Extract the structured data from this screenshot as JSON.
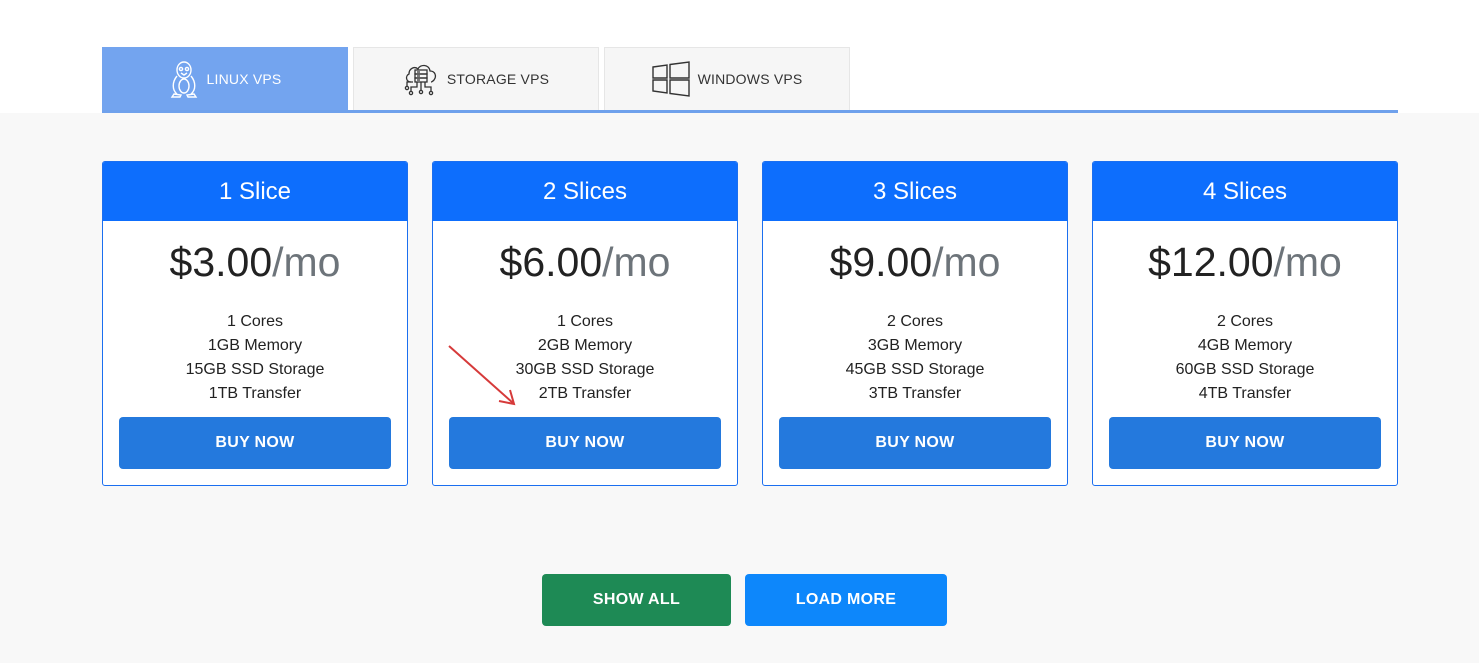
{
  "tabs": [
    {
      "label": "LINUX VPS",
      "icon": "linux-penguin-icon",
      "active": true
    },
    {
      "label": "STORAGE VPS",
      "icon": "cloud-storage-icon",
      "active": false
    },
    {
      "label": "WINDOWS VPS",
      "icon": "windows-logo-icon",
      "active": false
    }
  ],
  "plans": [
    {
      "title": "1 Slice",
      "price": "$3.00",
      "per": "/mo",
      "features": [
        "1 Cores",
        "1GB Memory",
        "15GB SSD Storage",
        "1TB Transfer"
      ],
      "button": "BUY NOW"
    },
    {
      "title": "2 Slices",
      "price": "$6.00",
      "per": "/mo",
      "features": [
        "1 Cores",
        "2GB Memory",
        "30GB SSD Storage",
        "2TB Transfer"
      ],
      "button": "BUY NOW"
    },
    {
      "title": "3 Slices",
      "price": "$9.00",
      "per": "/mo",
      "features": [
        "2 Cores",
        "3GB Memory",
        "45GB SSD Storage",
        "3TB Transfer"
      ],
      "button": "BUY NOW"
    },
    {
      "title": "4 Slices",
      "price": "$12.00",
      "per": "/mo",
      "features": [
        "2 Cores",
        "4GB Memory",
        "60GB SSD Storage",
        "4TB Transfer"
      ],
      "button": "BUY NOW"
    }
  ],
  "actions": {
    "show_all": "SHOW ALL",
    "load_more": "LOAD MORE"
  },
  "colors": {
    "tab_active": "#73a4ef",
    "card_header": "#0d6efd",
    "buy_button": "#2479dd",
    "show_all": "#1e8a55",
    "load_more": "#0d87fb",
    "annotation_arrow": "#d63a3a"
  }
}
